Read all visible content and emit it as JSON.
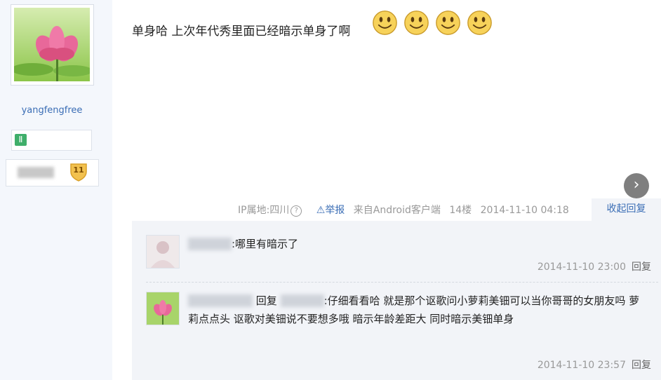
{
  "user": {
    "name": "yangfengfree",
    "zodiac_icon": "gemini-icon",
    "level": "11"
  },
  "post": {
    "text": "单身哈 上次年代秀里面已经暗示单身了啊",
    "emoticons": [
      "smiley-icon",
      "smiley-icon",
      "smiley-icon",
      "smiley-icon"
    ],
    "ip": "IP属地:四川",
    "report": "举报",
    "source": "来自Android客户端",
    "floor": "14楼",
    "time": "2014-11-10 04:18",
    "collapse": "收起回复"
  },
  "replies": [
    {
      "text": ":哪里有暗示了",
      "time": "2014-11-10 23:00",
      "reply_label": "回复"
    },
    {
      "reply_word": "回复",
      "text": ":仔细看看哈 就是那个讴歌问小萝莉美钿可以当你哥哥的女朋友吗 萝莉点点头 讴歌对美钿说不要想多哦 暗示年龄差距大 同时暗示美钿单身",
      "time": "2014-11-10 23:57",
      "reply_label": "回复"
    }
  ],
  "colors": {
    "link": "#3a6db5",
    "sidebar_bg": "#f4f7fc",
    "reply_bg": "#f2f4f8"
  }
}
